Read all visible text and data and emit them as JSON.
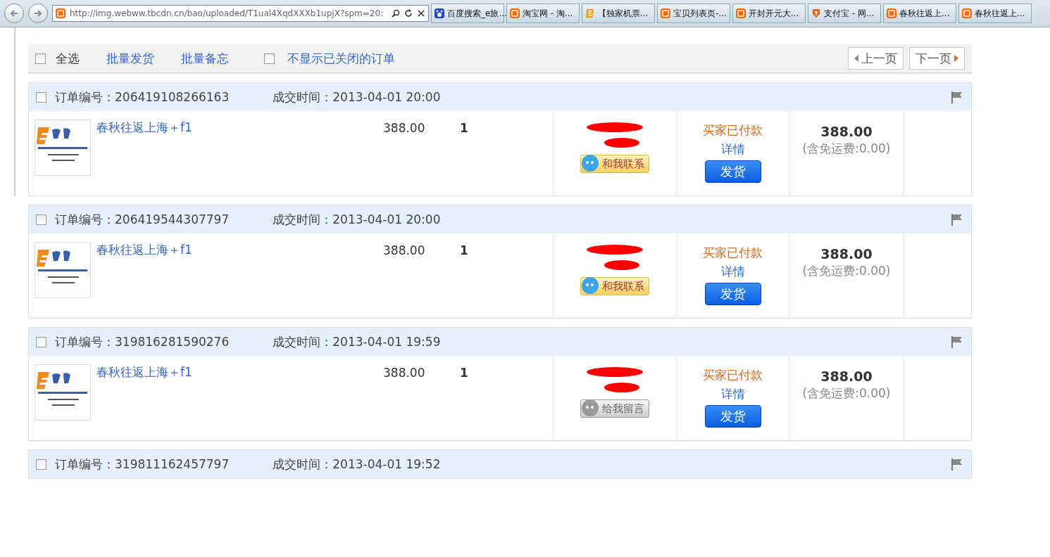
{
  "browser": {
    "address": "http://img.webww.tbcdn.cn/bao/uploaded/T1ual4XqdXXXb1upjX?spm=20:",
    "tabs": [
      {
        "title": "百度搜索_e旅...",
        "kind": "paw"
      },
      {
        "title": "淘宝网 - 淘...",
        "kind": "tao"
      },
      {
        "title": "【独家机票...",
        "kind": "e"
      },
      {
        "title": "宝贝列表页-...",
        "kind": "tao"
      },
      {
        "title": "开封开元大...",
        "kind": "tao"
      },
      {
        "title": "支付宝 - 网...",
        "kind": "pay"
      },
      {
        "title": "春秋往返上...",
        "kind": "tao"
      },
      {
        "title": "春秋往返上...",
        "kind": "tao"
      }
    ]
  },
  "toolbar": {
    "select_all": {
      "label": "全选",
      "checked": false
    },
    "links": [
      "批量发货",
      "批量备忘"
    ],
    "hide_closed": {
      "label": "不显示已关闭的订单",
      "checked": false
    },
    "prev": "上一页",
    "next": "下一页"
  },
  "orders": [
    {
      "checked": false,
      "number_label": "订单编号：",
      "number": "206419108266163",
      "time_label": "成交时间：",
      "time": "2013-04-01 20:00",
      "product": "春秋往返上海＋f1",
      "price": "388.00",
      "qty": "1",
      "contact": {
        "label": "和我联系",
        "online": true
      },
      "status": "买家已付款",
      "details": "详情",
      "ship": "发货",
      "total": "388.00",
      "shipping": "(含免运费:0.00)"
    },
    {
      "checked": false,
      "number_label": "订单编号：",
      "number": "206419544307797",
      "time_label": "成交时间：",
      "time": "2013-04-01 20:00",
      "product": "春秋往返上海＋f1",
      "price": "388.00",
      "qty": "1",
      "contact": {
        "label": "和我联系",
        "online": true
      },
      "status": "买家已付款",
      "details": "详情",
      "ship": "发货",
      "total": "388.00",
      "shipping": "(含免运费:0.00)"
    },
    {
      "checked": false,
      "number_label": "订单编号：",
      "number": "319816281590276",
      "time_label": "成交时间：",
      "time": "2013-04-01 19:59",
      "product": "春秋往返上海＋f1",
      "price": "388.00",
      "qty": "1",
      "contact": {
        "label": "给我留言",
        "online": false
      },
      "status": "买家已付款",
      "details": "详情",
      "ship": "发货",
      "total": "388.00",
      "shipping": "(含免运费:0.00)"
    },
    {
      "checked": false,
      "number_label": "订单编号：",
      "number": "319811162457797",
      "time_label": "成交时间：",
      "time": "2013-04-01 19:52"
    }
  ]
}
